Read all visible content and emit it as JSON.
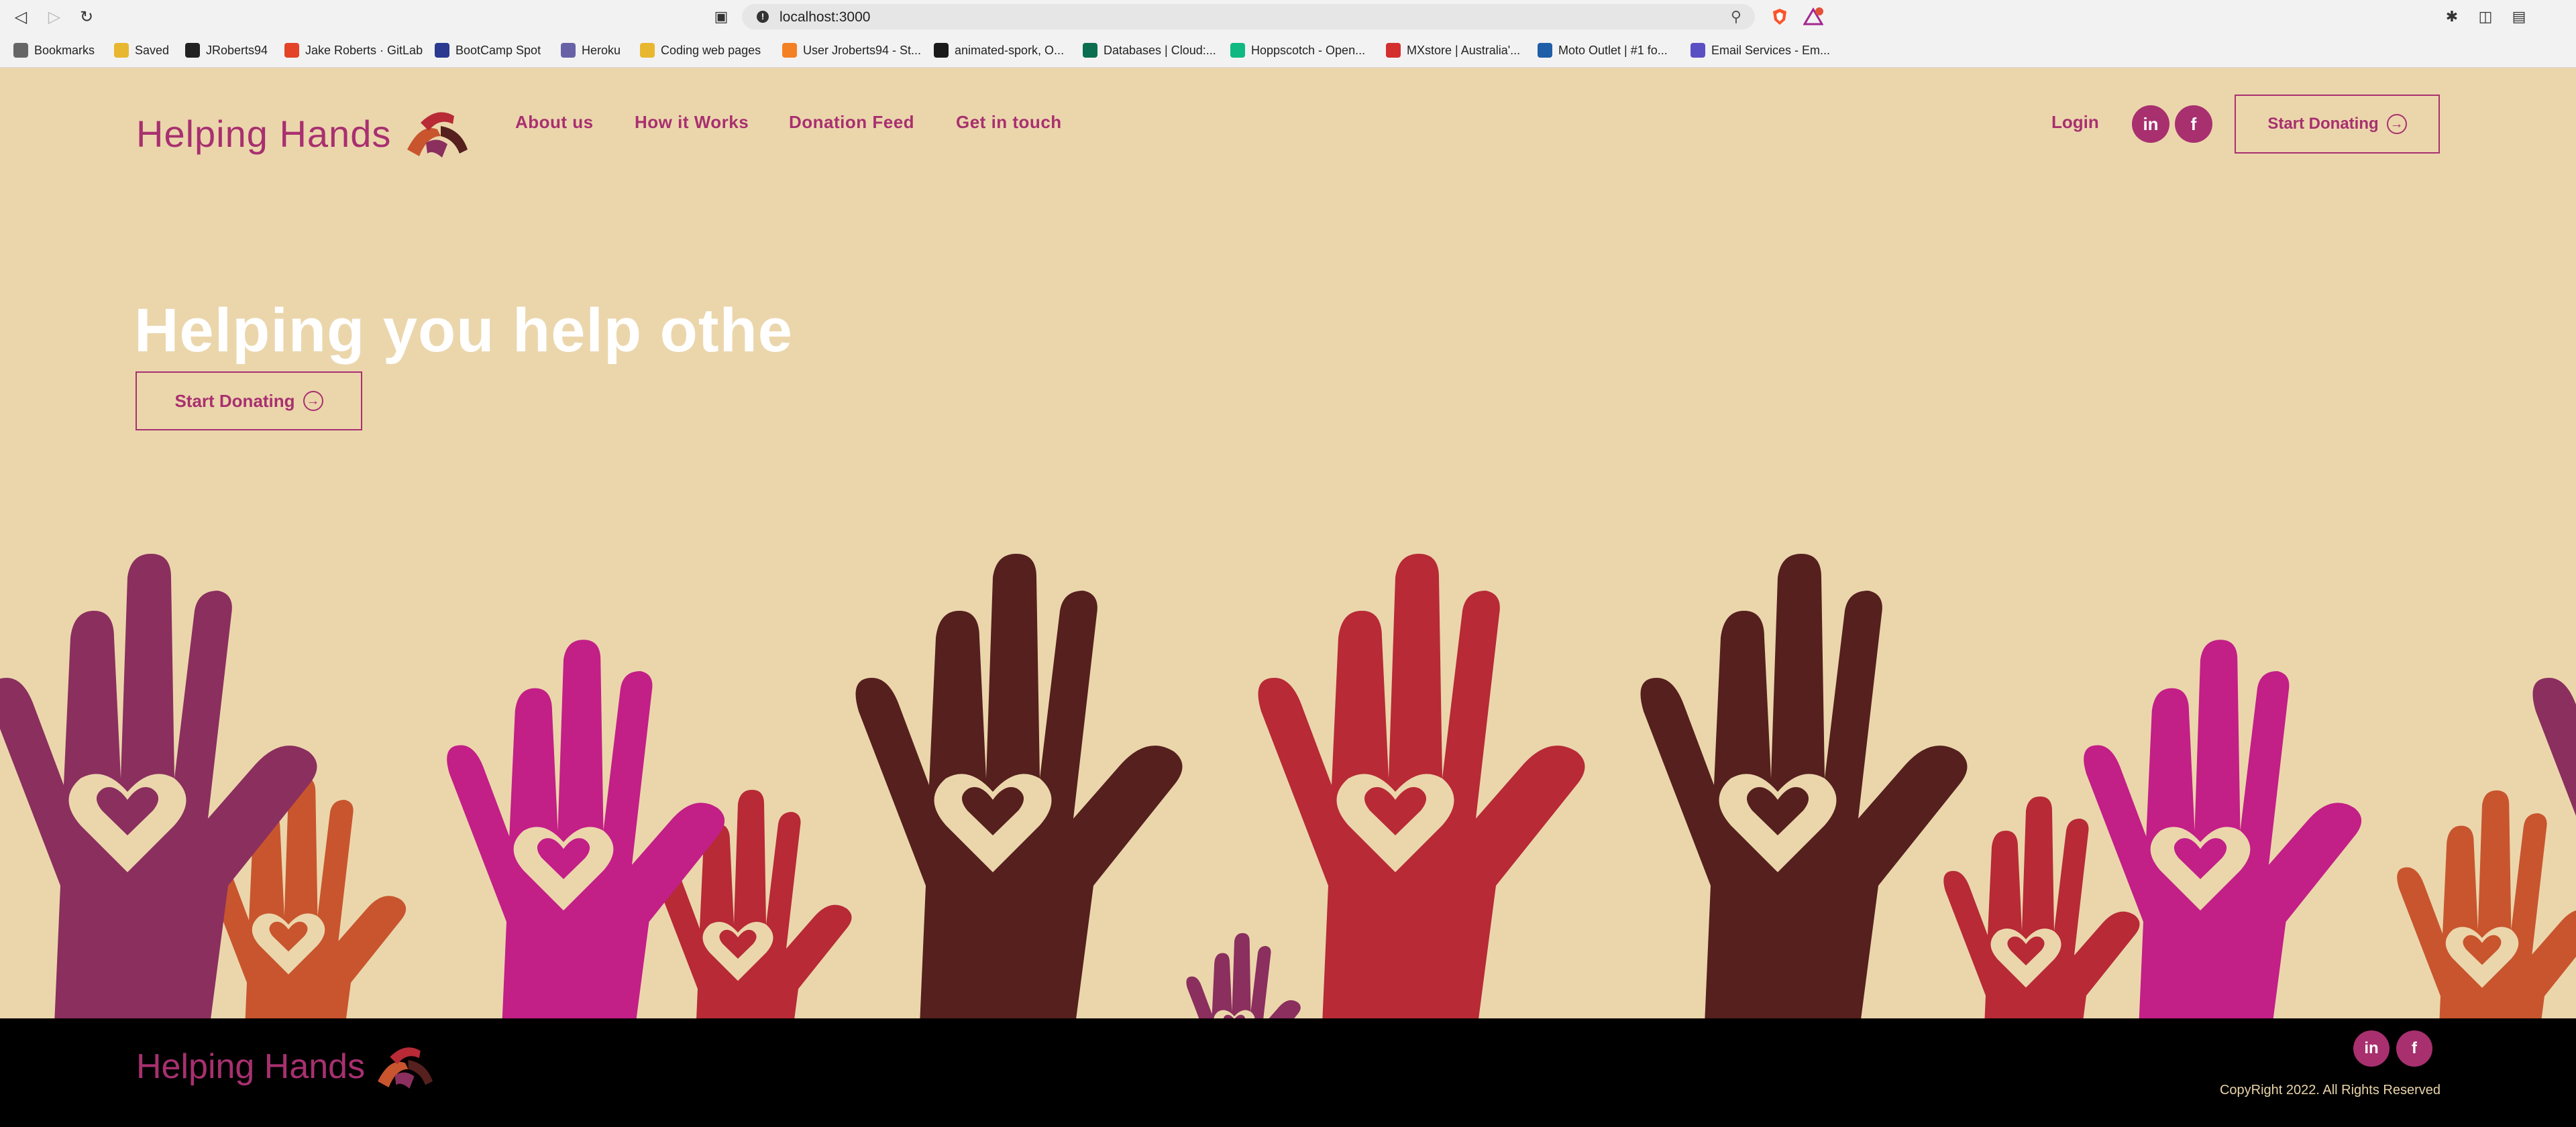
{
  "browser": {
    "url": "localhost:3000",
    "bookmarks": [
      {
        "label": "Bookmarks",
        "color": "#666666"
      },
      {
        "label": "Saved",
        "color": "#e8b730"
      },
      {
        "label": "JRoberts94",
        "color": "#222222"
      },
      {
        "label": "Jake Roberts · GitLab",
        "color": "#e24329"
      },
      {
        "label": "BootCamp Spot",
        "color": "#2b3990"
      },
      {
        "label": "Heroku",
        "color": "#6762a6"
      },
      {
        "label": "Coding web pages",
        "color": "#e8b730"
      },
      {
        "label": "User Jroberts94 - St...",
        "color": "#f48024"
      },
      {
        "label": "animated-spork, O...",
        "color": "#1a1a1a"
      },
      {
        "label": "Databases | Cloud:...",
        "color": "#0b6e4f"
      },
      {
        "label": "Hoppscotch - Open...",
        "color": "#10b981"
      },
      {
        "label": "MXstore | Australia'...",
        "color": "#d32f2f"
      },
      {
        "label": "Moto Outlet | #1 fo...",
        "color": "#1e5fa8"
      },
      {
        "label": "Email Services - Em...",
        "color": "#5b4fc4"
      }
    ]
  },
  "site": {
    "brand": "Helping Hands",
    "nav": [
      "About us",
      "How it Works",
      "Donation Feed",
      "Get in touch"
    ],
    "login": "Login",
    "cta": "Start Donating",
    "social": {
      "linkedin": "in",
      "facebook": "f"
    },
    "hero_title": "Helping you help othe",
    "hero_cta": "Start Donating",
    "copyright": "CopyRight 2022. All Rights Reserved"
  },
  "colors": {
    "accent": "#a8306f",
    "background": "#ebd6ac",
    "footer": "#000000",
    "hand_purple": "#8a2f5e",
    "hand_orange": "#c8552e",
    "hand_magenta": "#c21f87",
    "hand_red": "#b72a36",
    "hand_brown": "#55201e"
  }
}
